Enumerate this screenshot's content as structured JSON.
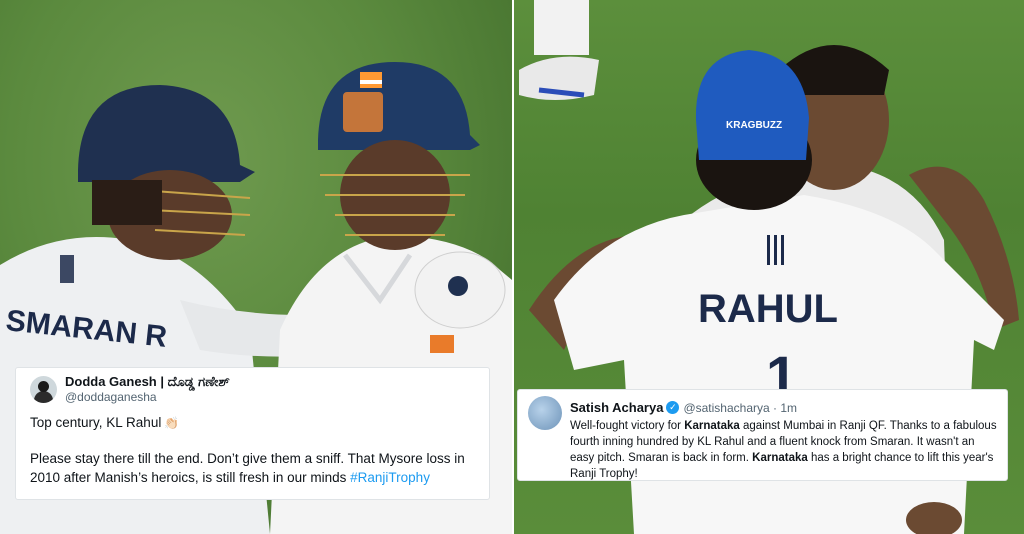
{
  "tweets": [
    {
      "name": "Dodda Ganesh | ದೊಡ್ಡ ಗಣೇಶ್",
      "handle": "@doddaganesha",
      "line1": "Top century, KL Rahul",
      "line1_emoji": "👏🏻",
      "line2": "Please stay there till the end. Don’t give them a sniff. That Mysore loss in 2010 after Manish’s heroics, is still fresh in our minds",
      "hashtag": "#RanjiTrophy"
    },
    {
      "name": "Satish Acharya",
      "handle": "@satishacharya · 1m",
      "parts": [
        {
          "t": "Well-fought victory for ",
          "b": false
        },
        {
          "t": "Karnataka",
          "b": true
        },
        {
          "t": " against Mumbai in Ranji QF. Thanks to a fabulous fourth inning hundred by KL Rahul and a fluent knock from Smaran. It wasn't an easy pitch. Smaran is back in form. ",
          "b": false
        },
        {
          "t": "Karnataka",
          "b": true
        },
        {
          "t": " has a bright chance to lift this year's Ranji Trophy!",
          "b": false
        }
      ]
    }
  ],
  "jerseys": {
    "left_name": "SMARAN R",
    "right_name": "RAHUL",
    "right_number": "1",
    "cap_text": "KRAGBUZZ"
  },
  "colors": {
    "grass": "#5b8a3e",
    "helmet": "#1f3050",
    "cap": "#1f5bbf",
    "jersey_text": "#1c2a4a",
    "link": "#1d9bf0"
  }
}
